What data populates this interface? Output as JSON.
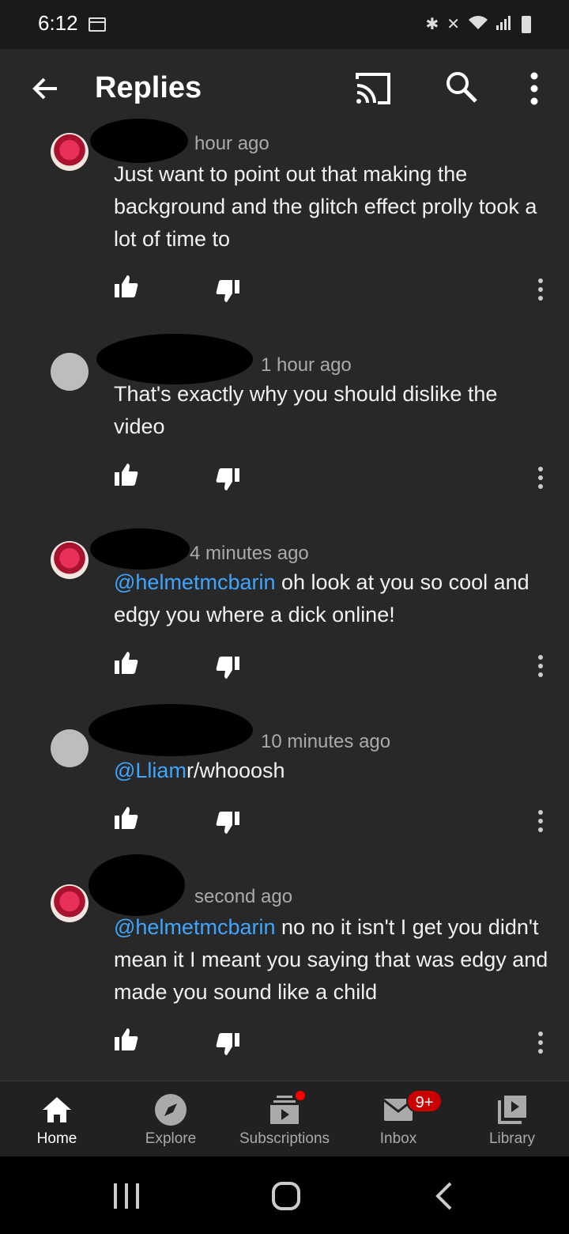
{
  "status_bar": {
    "time": "6:12",
    "icons": [
      "calendar-icon",
      "bluetooth-icon",
      "mute-icon",
      "wifi-icon",
      "signal-icon",
      "battery-icon"
    ]
  },
  "app_bar": {
    "title": "Replies",
    "icons": [
      "back-arrow-icon",
      "cast-icon",
      "search-icon",
      "more-vert-icon"
    ]
  },
  "comments": [
    {
      "time": "hour ago",
      "segments": [
        {
          "text": "Just want to point out that making the background and the glitch effect prolly took a lot of time to",
          "mention": false
        }
      ]
    },
    {
      "time": "1 hour ago",
      "segments": [
        {
          "text": "That's exactly why you should dislike the video",
          "mention": false
        }
      ]
    },
    {
      "time": "4 minutes ago",
      "segments": [
        {
          "text": "@helmetmcbarin",
          "mention": true
        },
        {
          "text": " oh look at you so cool and edgy you where a dick online!",
          "mention": false
        }
      ]
    },
    {
      "time": "10 minutes ago",
      "segments": [
        {
          "text": "@Lliam",
          "mention": true
        },
        {
          "text": "r/whooosh",
          "mention": false
        }
      ]
    },
    {
      "time": "second ago",
      "segments": [
        {
          "text": "@helmetmcbarin",
          "mention": true
        },
        {
          "text": " no no it isn't I get you didn't mean it I meant you saying that was edgy and made you sound like a child",
          "mention": false
        }
      ]
    }
  ],
  "bottom_nav": {
    "items": [
      {
        "label": "Home",
        "icon": "home-icon",
        "active": true
      },
      {
        "label": "Explore",
        "icon": "compass-icon",
        "active": false
      },
      {
        "label": "Subscriptions",
        "icon": "subscriptions-icon",
        "active": false,
        "dot": true
      },
      {
        "label": "Inbox",
        "icon": "mail-icon",
        "active": false,
        "badge": "9+"
      },
      {
        "label": "Library",
        "icon": "library-icon",
        "active": false
      }
    ]
  },
  "colors": {
    "background": "#282828",
    "mention": "#3ea6ff",
    "badge": "#cc0000",
    "meta": "#aaaaaa"
  }
}
